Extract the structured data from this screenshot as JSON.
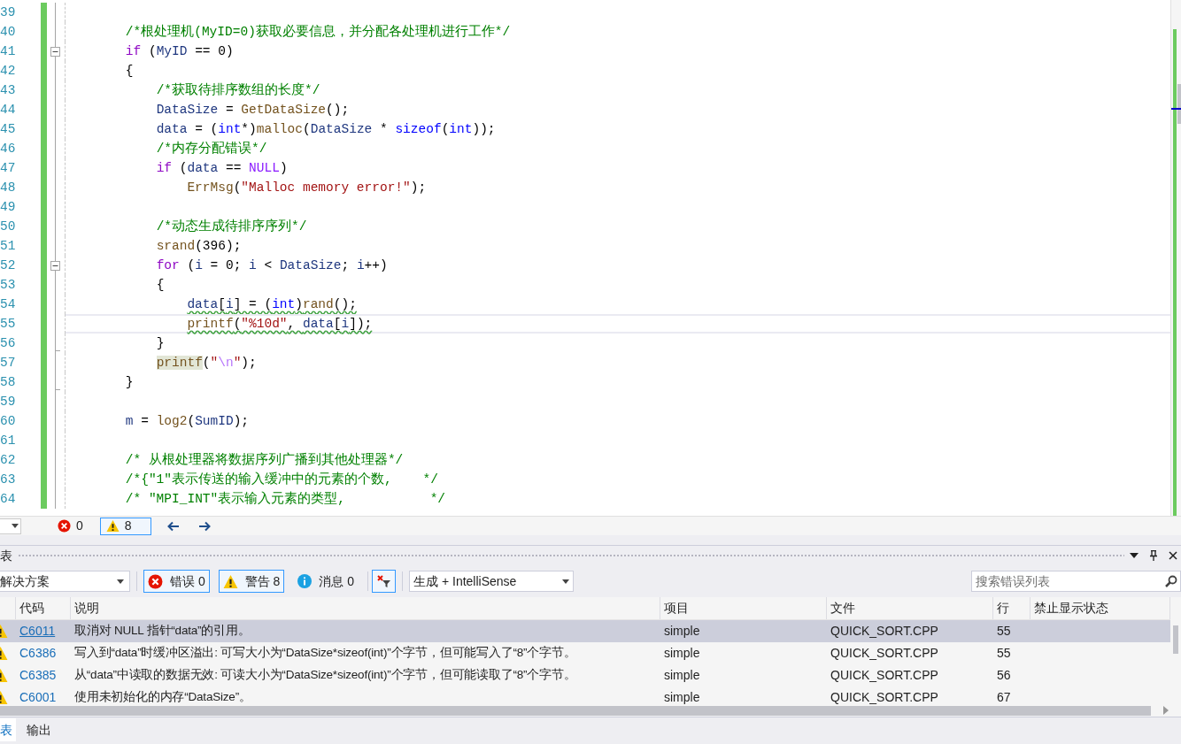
{
  "editor": {
    "lines": [
      {
        "number": "39",
        "kind": "plain"
      },
      {
        "number": "40",
        "kind": "plain",
        "current": false,
        "squiggle": false,
        "tokens": [
          {
            "kind": "cm",
            "text": "    /*根处理机(MyID=0)获取必要信息，并分配各处理机进行工作*/"
          }
        ]
      },
      {
        "number": "41",
        "kind": "fold-start",
        "current": false,
        "squiggle": false,
        "tokens": [
          {
            "kind": "ctl",
            "text": "    if"
          },
          {
            "kind": "t",
            "text": " ("
          },
          {
            "kind": "var",
            "text": "MyID"
          },
          {
            "kind": "t",
            "text": " == 0)"
          }
        ]
      },
      {
        "number": "42",
        "kind": "plain",
        "current": false,
        "squiggle": false,
        "tokens": [
          {
            "kind": "t",
            "text": "    {"
          }
        ]
      },
      {
        "number": "43",
        "kind": "plain",
        "current": false,
        "squiggle": false,
        "tokens": [
          {
            "kind": "cm",
            "text": "        /*获取待排序数组的长度*/"
          }
        ]
      },
      {
        "number": "44",
        "kind": "plain",
        "current": false,
        "squiggle": false,
        "tokens": [
          {
            "kind": "var",
            "text": "        DataSize"
          },
          {
            "kind": "t",
            "text": " = "
          },
          {
            "kind": "fn",
            "text": "GetDataSize"
          },
          {
            "kind": "t",
            "text": "();"
          }
        ]
      },
      {
        "number": "45",
        "kind": "plain",
        "current": false,
        "squiggle": false,
        "tokens": [
          {
            "kind": "var",
            "text": "        data"
          },
          {
            "kind": "t",
            "text": " = ("
          },
          {
            "kind": "kw",
            "text": "int"
          },
          {
            "kind": "t",
            "text": "*)"
          },
          {
            "kind": "fn",
            "text": "malloc"
          },
          {
            "kind": "t",
            "text": "("
          },
          {
            "kind": "var",
            "text": "DataSize"
          },
          {
            "kind": "t",
            "text": " * "
          },
          {
            "kind": "kw",
            "text": "sizeof"
          },
          {
            "kind": "t",
            "text": "("
          },
          {
            "kind": "kw",
            "text": "int"
          },
          {
            "kind": "t",
            "text": "));"
          }
        ]
      },
      {
        "number": "46",
        "kind": "plain",
        "current": false,
        "squiggle": false,
        "tokens": [
          {
            "kind": "cm",
            "text": "        /*内存分配错误*/"
          }
        ]
      },
      {
        "number": "47",
        "kind": "plain",
        "current": false,
        "squiggle": false,
        "tokens": [
          {
            "kind": "ctl",
            "text": "        if"
          },
          {
            "kind": "t",
            "text": " ("
          },
          {
            "kind": "var",
            "text": "data"
          },
          {
            "kind": "t",
            "text": " == "
          },
          {
            "kind": "mac",
            "text": "NULL"
          },
          {
            "kind": "t",
            "text": ")"
          }
        ]
      },
      {
        "number": "48",
        "kind": "plain",
        "current": false,
        "squiggle": false,
        "tokens": [
          {
            "kind": "fn",
            "text": "            ErrMsg"
          },
          {
            "kind": "t",
            "text": "("
          },
          {
            "kind": "str",
            "text": "\"Malloc memory error!\""
          },
          {
            "kind": "t",
            "text": ");"
          }
        ]
      },
      {
        "number": "49",
        "kind": "plain"
      },
      {
        "number": "50",
        "kind": "plain",
        "current": false,
        "squiggle": false,
        "tokens": [
          {
            "kind": "cm",
            "text": "        /*动态生成待排序序列*/"
          }
        ]
      },
      {
        "number": "51",
        "kind": "plain",
        "current": false,
        "squiggle": false,
        "tokens": [
          {
            "kind": "fn",
            "text": "        srand"
          },
          {
            "kind": "t",
            "text": "(396);"
          }
        ]
      },
      {
        "number": "52",
        "kind": "fold-start",
        "current": false,
        "squiggle": false,
        "tokens": [
          {
            "kind": "ctl",
            "text": "        for"
          },
          {
            "kind": "t",
            "text": " ("
          },
          {
            "kind": "var",
            "text": "i"
          },
          {
            "kind": "t",
            "text": " = 0; "
          },
          {
            "kind": "var",
            "text": "i"
          },
          {
            "kind": "t",
            "text": " < "
          },
          {
            "kind": "var",
            "text": "DataSize"
          },
          {
            "kind": "t",
            "text": "; "
          },
          {
            "kind": "var",
            "text": "i"
          },
          {
            "kind": "t",
            "text": "++)"
          }
        ]
      },
      {
        "number": "53",
        "kind": "plain",
        "current": false,
        "squiggle": false,
        "tokens": [
          {
            "kind": "t",
            "text": "        {"
          }
        ]
      },
      {
        "number": "54",
        "kind": "plain",
        "current": false,
        "squiggle": true,
        "tokens": [
          {
            "kind": "var",
            "text": "            data"
          },
          {
            "kind": "t",
            "text": "["
          },
          {
            "kind": "var",
            "text": "i"
          },
          {
            "kind": "t",
            "text": "] = ("
          },
          {
            "kind": "kw",
            "text": "int"
          },
          {
            "kind": "t",
            "text": ")"
          },
          {
            "kind": "fn",
            "text": "rand"
          },
          {
            "kind": "t",
            "text": "();"
          }
        ]
      },
      {
        "number": "55",
        "kind": "plain",
        "current": true,
        "squiggle": true,
        "tokens": [
          {
            "kind": "fn",
            "text": "            printf"
          },
          {
            "kind": "t",
            "text": "("
          },
          {
            "kind": "str",
            "text": "\"%10d\""
          },
          {
            "kind": "t",
            "text": ", "
          },
          {
            "kind": "var",
            "text": "data"
          },
          {
            "kind": "t",
            "text": "["
          },
          {
            "kind": "var",
            "text": "i"
          },
          {
            "kind": "t",
            "text": "]);"
          }
        ]
      },
      {
        "number": "56",
        "kind": "fold-end",
        "current": false,
        "squiggle": false,
        "tokens": [
          {
            "kind": "t",
            "text": "        }"
          }
        ]
      },
      {
        "number": "57",
        "kind": "plain",
        "current": false,
        "squiggle": false,
        "tokens": [
          {
            "kind": "fnh",
            "text": "        printf"
          },
          {
            "kind": "t",
            "text": "("
          },
          {
            "kind": "str",
            "text": "\""
          },
          {
            "kind": "esc",
            "text": "\\n"
          },
          {
            "kind": "str",
            "text": "\""
          },
          {
            "kind": "t",
            "text": ");"
          }
        ]
      },
      {
        "number": "58",
        "kind": "fold-end",
        "current": false,
        "squiggle": false,
        "tokens": [
          {
            "kind": "t",
            "text": "    }"
          }
        ]
      },
      {
        "number": "59",
        "kind": "plain"
      },
      {
        "number": "60",
        "kind": "plain",
        "current": false,
        "squiggle": false,
        "tokens": [
          {
            "kind": "var",
            "text": "    m"
          },
          {
            "kind": "t",
            "text": " = "
          },
          {
            "kind": "fn",
            "text": "log2"
          },
          {
            "kind": "t",
            "text": "("
          },
          {
            "kind": "var",
            "text": "SumID"
          },
          {
            "kind": "t",
            "text": ");"
          }
        ]
      },
      {
        "number": "61",
        "kind": "plain"
      },
      {
        "number": "62",
        "kind": "plain",
        "current": false,
        "squiggle": false,
        "tokens": [
          {
            "kind": "cm",
            "text": "    /* 从根处理器将数据序列广播到其他处理器*/"
          }
        ]
      },
      {
        "number": "63",
        "kind": "plain",
        "current": false,
        "squiggle": false,
        "tokens": [
          {
            "kind": "cm",
            "text": "    /*{\"1\"表示传送的输入缓冲中的元素的个数,    */"
          }
        ]
      },
      {
        "number": "64",
        "kind": "plain",
        "current": false,
        "squiggle": false,
        "tokens": [
          {
            "kind": "cm",
            "text": "    /* \"MPI_INT\"表示输入元素的类型,           */"
          }
        ]
      }
    ]
  },
  "status_strip": {
    "counts": [
      {
        "kind": "error",
        "count": "0",
        "selected": false
      },
      {
        "kind": "warning",
        "count": "8",
        "selected": true
      }
    ]
  },
  "error_list": {
    "title": "表",
    "scope": "解决方案",
    "filters": [
      {
        "kind": "error",
        "label": "错误 0",
        "selected": true
      },
      {
        "kind": "warning",
        "label": "警告 8",
        "selected": true
      },
      {
        "kind": "info",
        "label": "消息 0",
        "selected": false
      }
    ],
    "source": "生成 + IntelliSense",
    "search": {
      "placeholder": "搜索错误列表"
    },
    "columns": [
      "代码",
      "说明",
      "项目",
      "文件",
      "行",
      "禁止显示状态"
    ],
    "rows": [
      {
        "code": "C6011",
        "description": "取消对 NULL 指针“data”的引用。",
        "project": "simple",
        "file": "QUICK_SORT.CPP",
        "line": "55",
        "selected": true
      },
      {
        "code": "C6386",
        "description": "写入到“data”时缓冲区溢出: 可写大小为“DataSize*sizeof(int)”个字节，但可能写入了“8”个字节。",
        "project": "simple",
        "file": "QUICK_SORT.CPP",
        "line": "55",
        "selected": false
      },
      {
        "code": "C6385",
        "description": "从“data”中读取的数据无效: 可读大小为“DataSize*sizeof(int)”个字节，但可能读取了“8”个字节。",
        "project": "simple",
        "file": "QUICK_SORT.CPP",
        "line": "56",
        "selected": false
      },
      {
        "code": "C6001",
        "description": "使用未初始化的内存“DataSize”。",
        "project": "simple",
        "file": "QUICK_SORT.CPP",
        "line": "67",
        "selected": false
      }
    ]
  },
  "bottom_tabs": [
    {
      "label": "表",
      "selected": true
    },
    {
      "label": "输出",
      "selected": false
    }
  ]
}
